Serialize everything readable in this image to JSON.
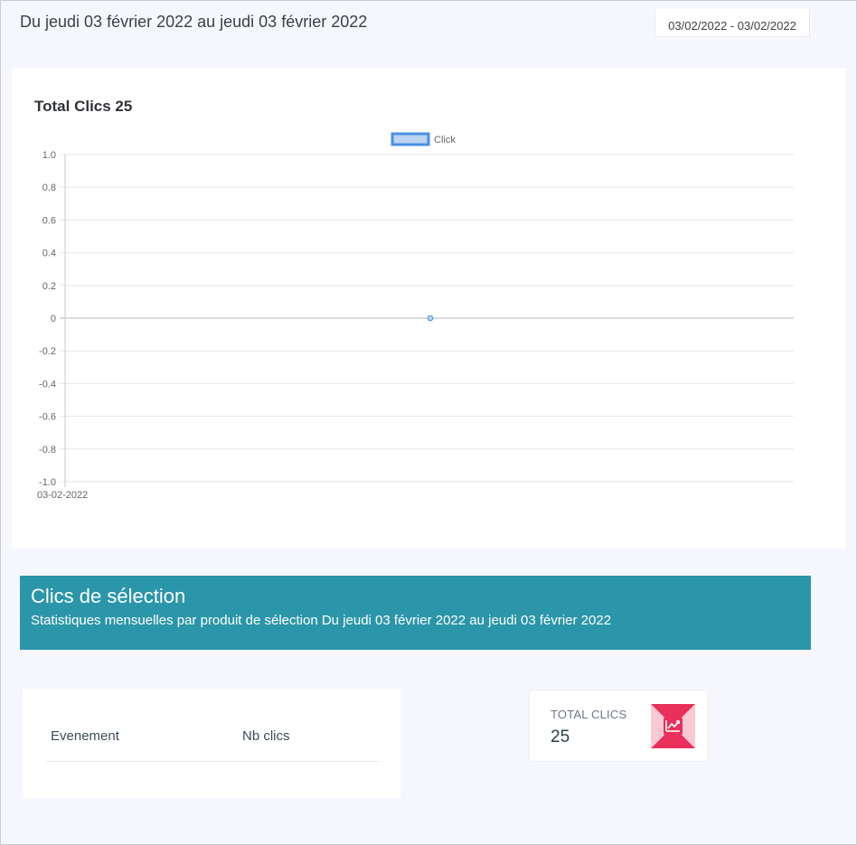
{
  "header": {
    "title": "Du jeudi 03 février 2022 au jeudi 03 février 2022",
    "date_range": "03/02/2022 - 03/02/2022"
  },
  "chart_card": {
    "title": "Total Clics 25"
  },
  "chart_data": {
    "type": "line",
    "title": "Total Clics 25",
    "xlabel": "",
    "ylabel": "",
    "x": [
      "03-02-2022"
    ],
    "series": [
      {
        "name": "Click",
        "values": [
          0
        ]
      }
    ],
    "ylim": [
      -1.0,
      1.0
    ],
    "yticks": [
      "1.0",
      "0.8",
      "0.6",
      "0.4",
      "0.2",
      "0",
      "-0.2",
      "-0.4",
      "-0.6",
      "-0.8",
      "-1.0"
    ],
    "ytick_values": [
      1.0,
      0.8,
      0.6,
      0.4,
      0.2,
      0,
      -0.2,
      -0.4,
      -0.6,
      -0.8,
      -1.0
    ],
    "grid": true,
    "legend": "top-center",
    "colors": {
      "line": "#4a90e2",
      "fill": "#b9d3f3"
    }
  },
  "banner": {
    "title": "Clics de sélection",
    "subtitle": "Statistiques mensuelles par produit de sélection Du jeudi 03 février 2022 au jeudi 03 février 2022",
    "color": "#2b96a9"
  },
  "table": {
    "columns": [
      "Evenement",
      "Nb clics"
    ],
    "rows": []
  },
  "total_card": {
    "label": "TOTAL CLICS",
    "value": "25",
    "icon": "line-chart-icon",
    "icon_color": "#e8305a"
  }
}
